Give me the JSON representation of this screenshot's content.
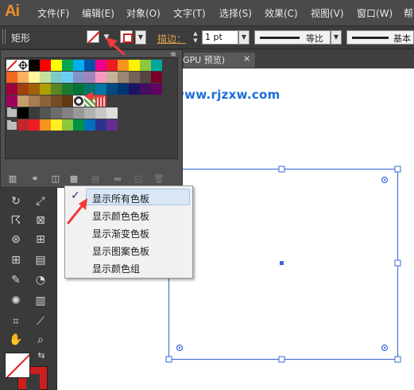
{
  "app": {
    "logo": "Ai"
  },
  "menu": [
    "文件(F)",
    "编辑(E)",
    "对象(O)",
    "文字(T)",
    "选择(S)",
    "效果(C)",
    "视图(V)",
    "窗口(W)",
    "帮"
  ],
  "control_bar": {
    "tool_name": "矩形",
    "stroke_label": "描边：",
    "stroke_weight": "1 pt",
    "stroke_profile_label": "等比",
    "brush_label": "基本"
  },
  "document_tab": {
    "label": "GPU 预览)",
    "close": "×"
  },
  "watermark": "www.rjzxw.com",
  "swatches_panel": {
    "menu_icon": "≡",
    "rows": [
      [
        "#ffffff",
        "#ffffff",
        "#000000",
        "#ff0000",
        "#ffff00",
        "#00a651",
        "#00aeef",
        "#0054a6",
        "#ec008c",
        "#ed1c24",
        "#f7941d",
        "#fff200",
        "#8dc63f",
        "#00a99d"
      ],
      [
        "#f26522",
        "#fbaf5d",
        "#fff799",
        "#c4df9b",
        "#7accc8",
        "#6dcff6",
        "#8393ca",
        "#a186be",
        "#f49ac1",
        "#c7b299",
        "#998675",
        "#736357",
        "#534741",
        "#7a0026"
      ],
      [
        "#9e0039",
        "#a0410d",
        "#a36209",
        "#aba000",
        "#598527",
        "#1a7b30",
        "#007236",
        "#00746b",
        "#0076a3",
        "#004a80",
        "#003471",
        "#1b1464",
        "#440e62",
        "#630460"
      ],
      [
        "#9e005d",
        "#c69c6d",
        "#a67c52",
        "#8c6239",
        "#754c24",
        "#603913",
        "#b0b0b0",
        "#3b6cb5",
        "#5e3a8a"
      ],
      [
        "#000000",
        "#3c3c3c",
        "#555555",
        "#6d6d6d",
        "#838383",
        "#999999",
        "#b0b0b0",
        "#c8c8c8",
        "#dedede"
      ],
      [
        "#c1272d",
        "#ed1c24",
        "#f7931e",
        "#fcee21",
        "#8cc63f",
        "#009245",
        "#0071bc",
        "#2e3192",
        "#662d91"
      ]
    ]
  },
  "context_menu": {
    "check": "✓",
    "items": [
      "显示所有色板",
      "显示颜色色板",
      "显示渐变色板",
      "显示图案色板",
      "显示颜色组"
    ]
  },
  "colors": {
    "menubar": "#4a4a4a",
    "panel": "#505050",
    "selection_handle": "#2f6ee0",
    "annotation_arrow": "#ee3b3b"
  }
}
